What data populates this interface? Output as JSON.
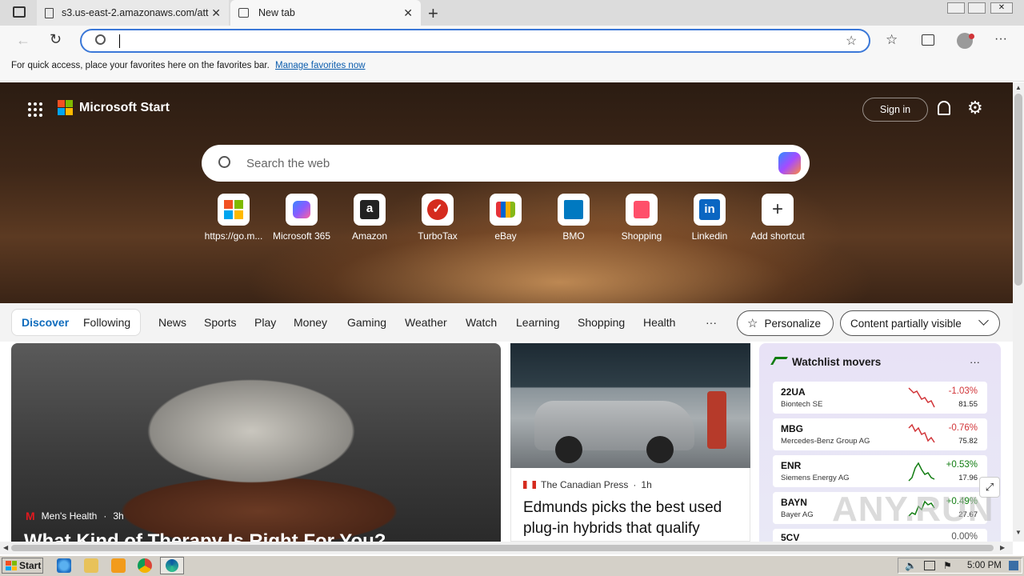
{
  "browser": {
    "tabs": [
      {
        "title": "s3.us-east-2.amazonaws.com/att"
      },
      {
        "title": "New tab"
      }
    ],
    "address_value": "",
    "favorites_bar": {
      "message": "For quick access, place your favorites here on the favorites bar.",
      "link": "Manage favorites now"
    }
  },
  "header": {
    "brand": "Microsoft Start",
    "signin_label": "Sign in"
  },
  "search": {
    "placeholder": "Search the web"
  },
  "shortcuts": [
    {
      "label": "https://go.m...",
      "icon": "windows-logo"
    },
    {
      "label": "Microsoft 365",
      "icon": "m365-logo"
    },
    {
      "label": "Amazon",
      "icon": "amazon-logo"
    },
    {
      "label": "TurboTax",
      "icon": "turbotax-logo"
    },
    {
      "label": "eBay",
      "icon": "ebay-logo"
    },
    {
      "label": "BMO",
      "icon": "bmo-logo"
    },
    {
      "label": "Shopping",
      "icon": "shopping-bag"
    },
    {
      "label": "Linkedin",
      "icon": "linkedin-logo"
    },
    {
      "label": "Add shortcut",
      "icon": "plus"
    }
  ],
  "feed_nav": {
    "tabs": [
      "Discover",
      "Following"
    ],
    "categories": [
      "News",
      "Sports",
      "Play",
      "Money",
      "Gaming",
      "Weather",
      "Watch",
      "Learning",
      "Shopping",
      "Health"
    ],
    "more": "···",
    "personalize": "Personalize",
    "content_visibility": "Content partially visible"
  },
  "cards": {
    "main": {
      "source": "Men's Health",
      "age": "3h",
      "headline": "What Kind of Therapy Is Right For You?"
    },
    "second": {
      "source": "The Canadian Press",
      "age": "1h",
      "headline": "Edmunds picks the best used plug-in hybrids that qualify"
    },
    "watchlist": {
      "title": "Watchlist movers",
      "more": "···",
      "stocks": [
        {
          "ticker": "22UA",
          "name": "Biontech SE",
          "change": "-1.03%",
          "price": "81.55",
          "direction": "down"
        },
        {
          "ticker": "MBG",
          "name": "Mercedes-Benz Group AG",
          "change": "-0.76%",
          "price": "75.82",
          "direction": "down"
        },
        {
          "ticker": "ENR",
          "name": "Siemens Energy AG",
          "change": "+0.53%",
          "price": "17.96",
          "direction": "up"
        },
        {
          "ticker": "BAYN",
          "name": "Bayer AG",
          "change": "+0.49%",
          "price": "27.67",
          "direction": "up"
        },
        {
          "ticker": "5CV",
          "name": "",
          "change": "0.00%",
          "price": "",
          "direction": "flat"
        }
      ]
    }
  },
  "taskbar": {
    "start_label": "Start",
    "clock": "5:00 PM"
  },
  "watermark": "ANY.RUN",
  "colors": {
    "accent": "#0f6cbd",
    "down": "#d13438",
    "up": "#107c10"
  }
}
